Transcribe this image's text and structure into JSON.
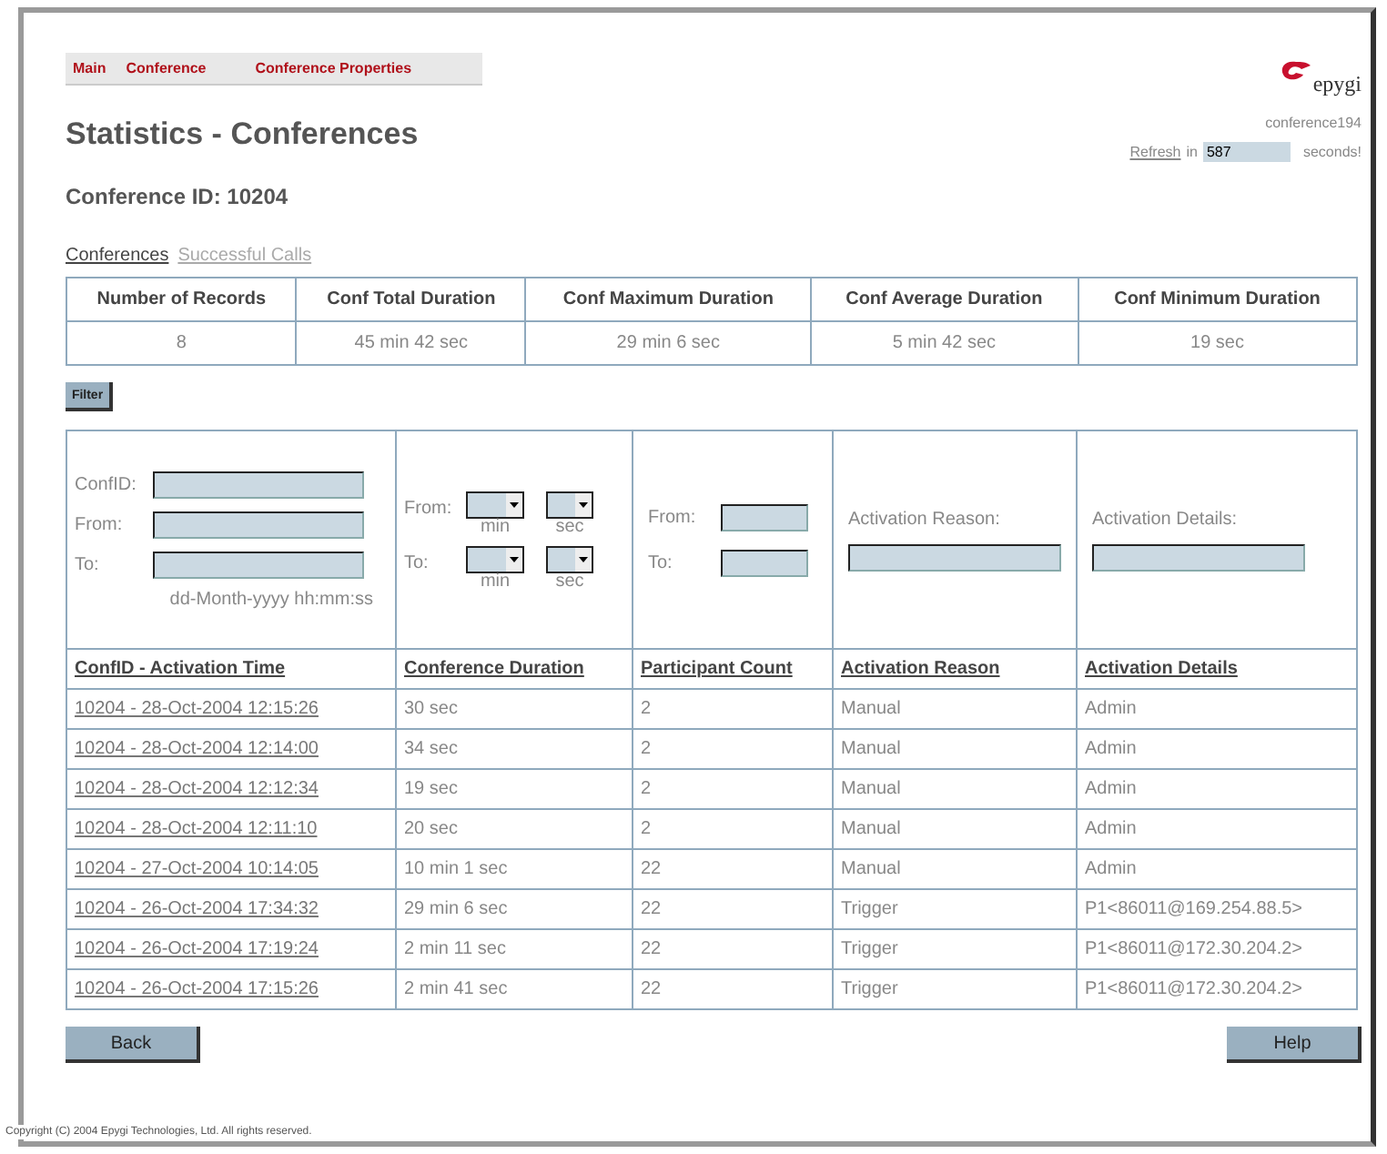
{
  "nav_tabs": [
    {
      "label": "Main"
    },
    {
      "label": "Conference"
    },
    {
      "label": "Conference Properties"
    }
  ],
  "logo": {
    "text": "epygi"
  },
  "device_name": "conference194",
  "refresh": {
    "link": "Refresh",
    "prefix": "in",
    "value": "587",
    "suffix": "seconds!"
  },
  "title": "Statistics - Conferences",
  "conference_id": "Conference ID: 10204",
  "sub_tabs": [
    {
      "label": "Conferences",
      "selected": true
    },
    {
      "label": "Successful Calls",
      "selected": false
    }
  ],
  "summary": {
    "columns": [
      "Number of Records",
      "Conf Total Duration",
      "Conf Maximum Duration",
      "Conf Average Duration",
      "Conf Minimum Duration"
    ],
    "values": [
      "8",
      "45 min 42 sec",
      "29 min 6 sec",
      "5 min 42 sec",
      "19 sec"
    ]
  },
  "filter_button": "Filter",
  "filter": {
    "confid_label": "ConfID:",
    "from_label": "From:",
    "to_label": "To:",
    "date_hint": "dd-Month-yyyy hh:mm:ss",
    "duration": [
      {
        "label": "From:",
        "min_label": "min",
        "sec_label": "sec"
      },
      {
        "label": "To:",
        "min_label": "min",
        "sec_label": "sec"
      }
    ],
    "count": {
      "from_label": "From:",
      "to_label": "To:"
    },
    "reason_label": "Activation Reason:",
    "details_label": "Activation Details:"
  },
  "table": {
    "columns": [
      "ConfID - Activation Time",
      "Conference Duration",
      "Participant Count",
      "Activation Reason",
      "Activation Details"
    ],
    "rows": [
      [
        "10204 - 28-Oct-2004 12:15:26",
        "30 sec",
        "2",
        "Manual",
        "Admin"
      ],
      [
        "10204 - 28-Oct-2004 12:14:00",
        "34 sec",
        "2",
        "Manual",
        "Admin"
      ],
      [
        "10204 - 28-Oct-2004 12:12:34",
        "19 sec",
        "2",
        "Manual",
        "Admin"
      ],
      [
        "10204 - 28-Oct-2004 12:11:10",
        "20 sec",
        "2",
        "Manual",
        "Admin"
      ],
      [
        "10204 - 27-Oct-2004 10:14:05",
        "10 min 1 sec",
        "22",
        "Manual",
        "Admin"
      ],
      [
        "10204 - 26-Oct-2004 17:34:32",
        "29 min 6 sec",
        "22",
        "Trigger",
        "P1<86011@169.254.88.5>"
      ],
      [
        "10204 - 26-Oct-2004 17:19:24",
        "2 min 11 sec",
        "22",
        "Trigger",
        "P1<86011@172.30.204.2>"
      ],
      [
        "10204 - 26-Oct-2004 17:15:26",
        "2 min 41 sec",
        "22",
        "Trigger",
        "P1<86011@172.30.204.2>"
      ]
    ]
  },
  "buttons": [
    "Back",
    "Help"
  ],
  "copyright": "Copyright (C) 2004 Epygi Technologies, Ltd. All rights reserved."
}
